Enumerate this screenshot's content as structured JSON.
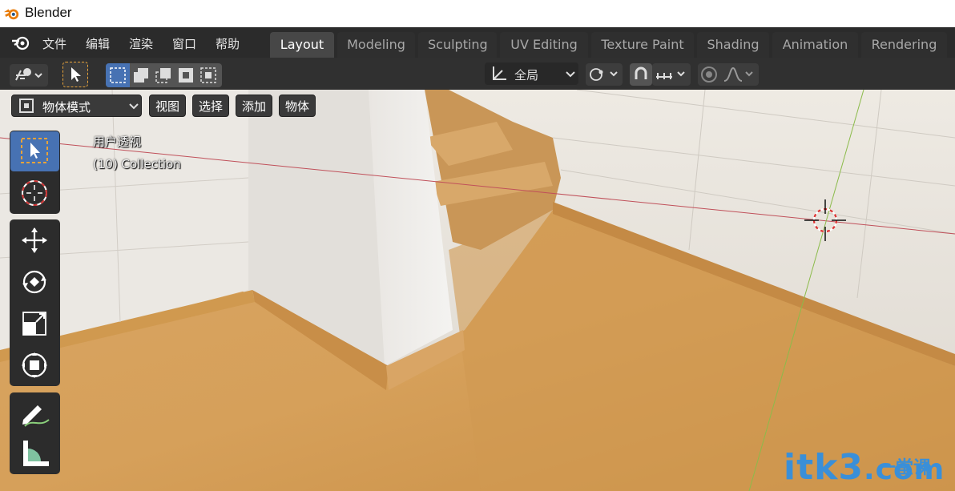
{
  "window": {
    "title": "Blender"
  },
  "menu": [
    "文件",
    "编辑",
    "渲染",
    "窗口",
    "帮助"
  ],
  "workspaces": [
    "Layout",
    "Modeling",
    "Sculpting",
    "UV Editing",
    "Texture Paint",
    "Shading",
    "Animation",
    "Rendering"
  ],
  "active_workspace": "Layout",
  "toolbar": {
    "orientation": "全局"
  },
  "viewport_header": {
    "mode": "物体模式",
    "menus": [
      "视图",
      "选择",
      "添加",
      "物体"
    ]
  },
  "viewport": {
    "view_name": "用户透视",
    "collection": "(10) Collection"
  },
  "tools": [
    "select-box",
    "cursor",
    "move",
    "rotate",
    "scale",
    "transform",
    "annotate",
    "measure"
  ],
  "active_tool": "select-box",
  "watermark": {
    "text": "itk3",
    "suffix": ".com",
    "cn": "一堂课"
  },
  "colors": {
    "accent": "#4772b3",
    "header": "#303030",
    "menubar": "#2b2b2b",
    "x_axis": "#c0505a",
    "y_axis": "#8bbb4a"
  }
}
